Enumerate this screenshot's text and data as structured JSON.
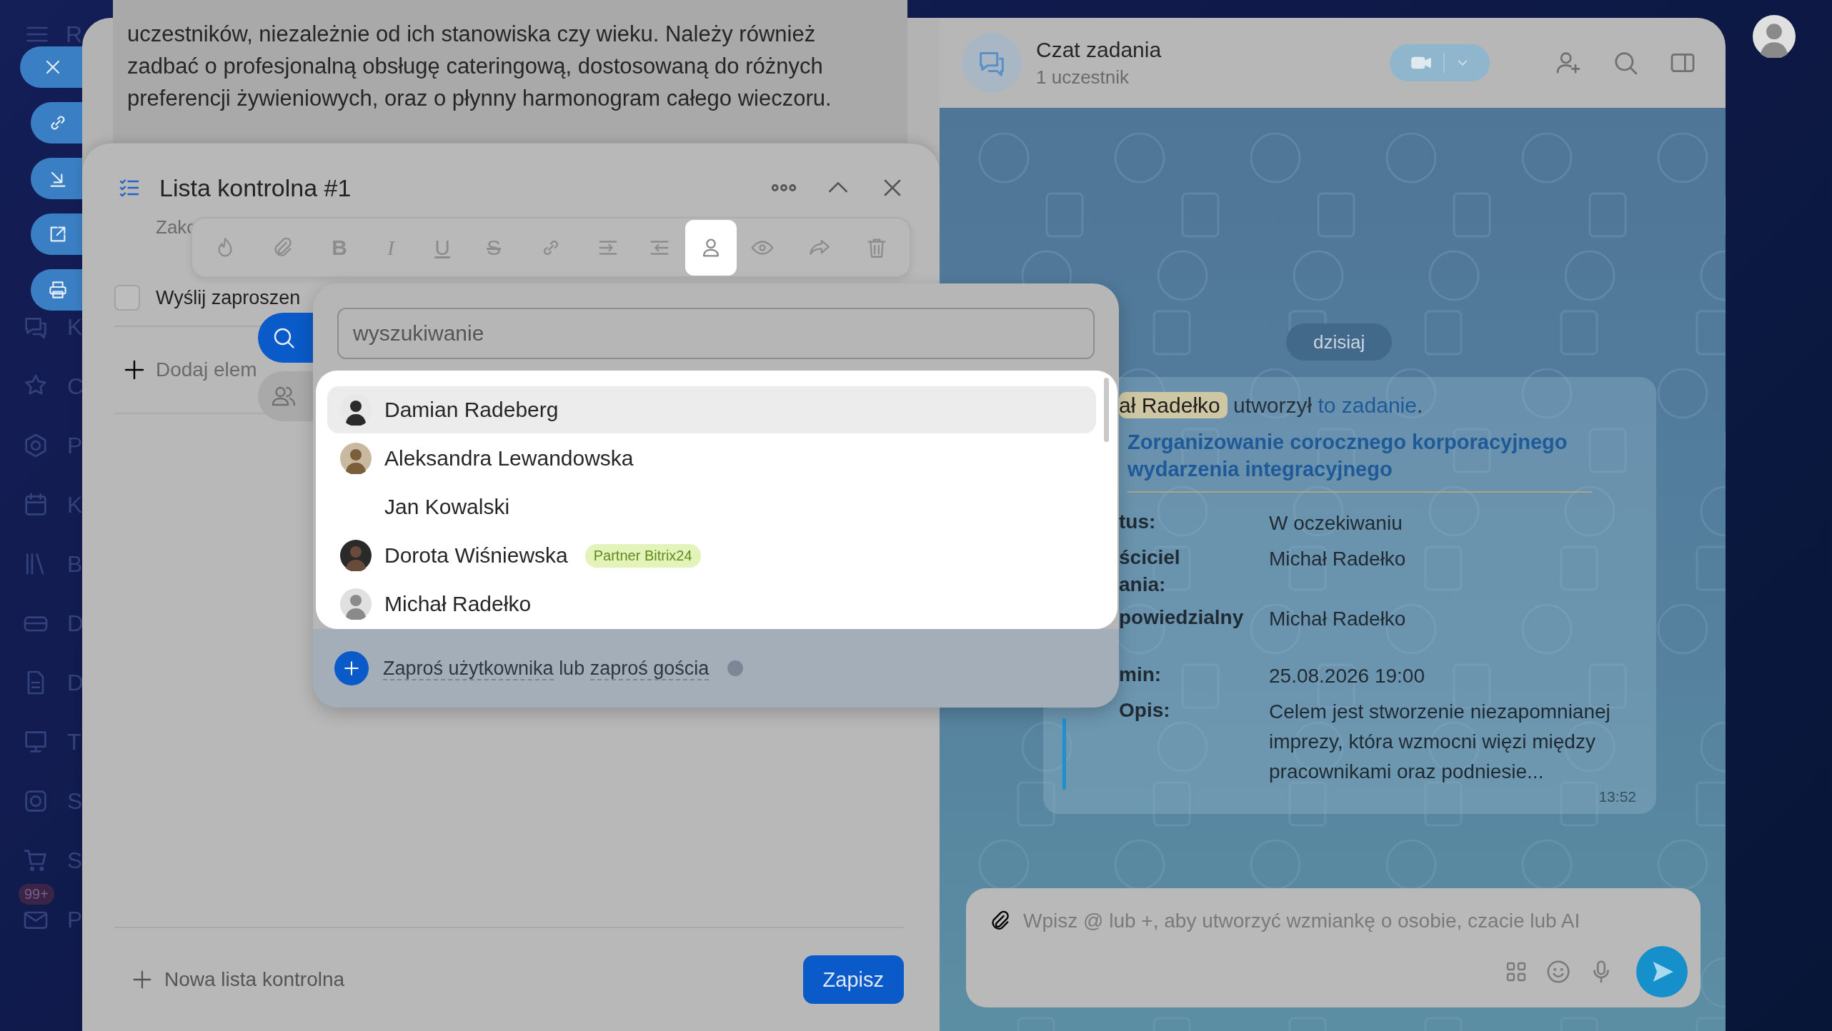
{
  "sidebar": {
    "header_letter": "R",
    "items": [
      {
        "kind": "chat",
        "label": "K"
      },
      {
        "kind": "star",
        "label": "C"
      },
      {
        "kind": "hexagon",
        "label": "P"
      },
      {
        "kind": "calendar",
        "label": "K"
      },
      {
        "kind": "books",
        "label": "B"
      },
      {
        "kind": "card",
        "label": "D"
      },
      {
        "kind": "doc",
        "label": "D"
      },
      {
        "kind": "board",
        "label": "T"
      },
      {
        "kind": "camera",
        "label": "S"
      },
      {
        "kind": "cart",
        "label": "S"
      },
      {
        "kind": "mail",
        "label": "P",
        "badge": "99+"
      }
    ]
  },
  "task_actions": [
    {
      "kind": "close"
    },
    {
      "kind": "link"
    },
    {
      "kind": "download"
    },
    {
      "kind": "external"
    },
    {
      "kind": "print"
    }
  ],
  "description": "uczestników, niezależnie od ich stanowiska czy wieku. Należy również zadbać o profesjonalną obsługę cateringową, dostosowaną do różnych preferencji żywieniowych, oraz o płynny harmonogram całego wieczoru.",
  "checklist": {
    "title": "Lista kontrolna #1",
    "subtitle": "Zakc",
    "items": [
      {
        "text": "Wyślij zaproszen",
        "checked": false
      }
    ],
    "add_item": "Dodaj elem",
    "new_list": "Nowa lista kontrolna",
    "save": "Zapisz"
  },
  "toolbar": [
    [
      {
        "kind": "fire",
        "selected": false
      }
    ],
    [
      {
        "kind": "clip",
        "selected": false
      }
    ],
    [
      {
        "kind": "bold",
        "label": "B",
        "selected": false
      },
      {
        "kind": "italic",
        "label": "I",
        "selected": false
      },
      {
        "kind": "underline",
        "label": "U",
        "selected": false
      },
      {
        "kind": "strike",
        "label": "S",
        "selected": false
      }
    ],
    [
      {
        "kind": "link",
        "selected": false
      }
    ],
    [
      {
        "kind": "indent",
        "selected": false
      },
      {
        "kind": "outdent",
        "selected": false
      },
      {
        "kind": "person",
        "selected": true
      },
      {
        "kind": "eye",
        "selected": false
      }
    ],
    [
      {
        "kind": "share",
        "selected": false
      }
    ],
    [
      {
        "kind": "trash",
        "selected": false
      }
    ]
  ],
  "side_buttons": [
    {
      "kind": "search"
    },
    {
      "kind": "group"
    }
  ],
  "mention_popup": {
    "search": {
      "placeholder": "wyszukiwanie"
    },
    "people": [
      {
        "name": "Damian Radeberg",
        "avatar": true,
        "selected": true
      },
      {
        "name": "Aleksandra Lewandowska",
        "avatar": true,
        "selected": false
      },
      {
        "name": "Jan Kowalski",
        "avatar": false,
        "selected": false
      },
      {
        "name": "Dorota Wiśniewska",
        "avatar": true,
        "selected": false,
        "badge": "Partner Bitrix24"
      },
      {
        "name": "Michał Radełko",
        "avatar": true,
        "selected": false
      }
    ],
    "footer": {
      "invite_user": "Zaproś użytkownika",
      "or": "lub",
      "invite_guest": "zaproś gościa"
    }
  },
  "chat": {
    "title": "Czat zadania",
    "subtitle": "1 uczestnik",
    "date": "dzisiaj",
    "message": {
      "author": "ał Radełko",
      "action": "utworzył",
      "link": "to zadanie",
      "end": ".",
      "task_title": "Zorganizowanie corocznego korporacyjnego wydarzenia integracyjnego",
      "fields": [
        {
          "label": "tus:",
          "value": "W oczekiwaniu"
        },
        {
          "label": "ściciel\nania:",
          "value": "Michał Radełko"
        },
        {
          "label": "powiedzialny",
          "value": "Michał Radełko"
        },
        {
          "label": "min:",
          "value": "25.08.2026 19:00"
        },
        {
          "label": "Opis:",
          "value": "Celem jest stworzenie niezapomnianej imprezy, która wzmocni więzi między pracownikami oraz podniesie..."
        }
      ],
      "time": "13:52"
    },
    "input": {
      "placeholder": "Wpisz @ lub +, aby utworzyć wzmiankę o osobie, czacie lub AI"
    }
  }
}
